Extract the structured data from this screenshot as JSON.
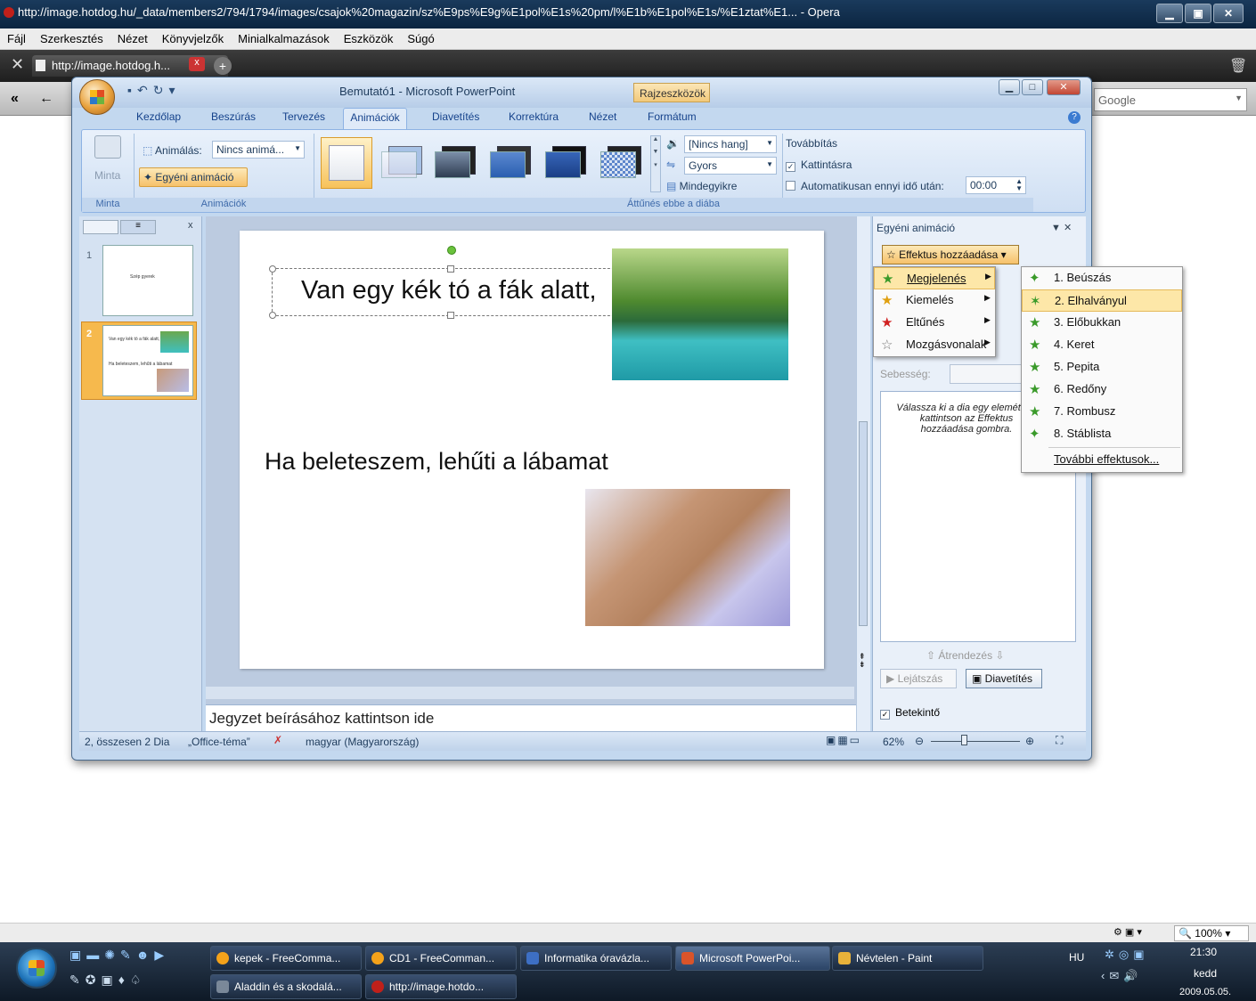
{
  "opera": {
    "title": "http://image.hotdog.hu/_data/members2/794/1794/images/csajok%20magazin/sz%E9ps%E9g%E1pol%E1s%20pm/l%E1b%E1pol%E1s/%E1ztat%E1... - Opera",
    "menu": [
      "Fájl",
      "Szerkesztés",
      "Nézet",
      "Könyvjelzők",
      "Minialkalmazások",
      "Eszközök",
      "Súgó"
    ],
    "tab_label": "http://image.hotdog.h...",
    "tab_close": "x",
    "search_placeholder": "Google",
    "status_zoom": "100%"
  },
  "ppt": {
    "title": "Bemutató1 - Microsoft PowerPoint",
    "context_tab": "Rajzeszközök",
    "tabs": [
      "Kezdőlap",
      "Beszúrás",
      "Tervezés",
      "Animációk",
      "Diavetítés",
      "Korrektúra",
      "Nézet",
      "Formátum"
    ],
    "active_tab": "Animációk",
    "ribbon": {
      "minta_button": "Minta",
      "minta_group": "Minta",
      "animalas_label": "Animálás:",
      "animalas_value": "Nincs animá...",
      "egyeni_animacio": "Egyéni animáció",
      "animaciok_group": "Animációk",
      "sound_value": "[Nincs hang]",
      "speed_value": "Gyors",
      "mindegyikre": "Mindegyikre",
      "transition_group": "Áttűnés ebbe a diába",
      "tovabbitas": "Továbbítás",
      "kattintasra": "Kattintásra",
      "automatikusan": "Automatikusan ennyi idő után:",
      "time_value": "00:00"
    },
    "thumbs": [
      {
        "number": "1",
        "text": "Szép gyerek"
      },
      {
        "number": "2",
        "text": "Van egy kék tó a fák alatt,",
        "text2": "Ha beleteszem, lehűti a lábamat"
      }
    ],
    "slide": {
      "line1": "Van egy kék tó a fák alatt,",
      "line2": "Ha beleteszem, lehűti a lábamat"
    },
    "notes_placeholder": "Jegyzet beírásához kattintson ide",
    "taskpane": {
      "title": "Egyéni animáció",
      "add_effect": "Effektus hozzáadása",
      "speed_label": "Sebesség:",
      "hint": "Válassza ki a dia egy elemét, és kattintson az Effektus hozzáadása gombra.",
      "reorder": "Átrendezés",
      "play": "Lejátszás",
      "slideshow": "Diavetítés",
      "preview": "Betekintő"
    },
    "effect_menu": [
      {
        "label": "Megjelenés",
        "color": "#3a9a2a"
      },
      {
        "label": "Kiemelés",
        "color": "#e0a010"
      },
      {
        "label": "Eltűnés",
        "color": "#d02020"
      },
      {
        "label": "Mozgásvonalak",
        "color": "#888888"
      }
    ],
    "submenu": [
      "1. Beúszás",
      "2. Elhalványul",
      "3. Előbukkan",
      "4. Keret",
      "5. Pepita",
      "6. Redőny",
      "7. Rombusz",
      "8. Stáblista",
      "További effektusok..."
    ],
    "status": {
      "slide_info": "2, összesen 2 Dia",
      "theme": "„Office-téma”",
      "language": "magyar (Magyarország)",
      "zoom": "62%"
    }
  },
  "taskbar": {
    "row1": [
      "kepek - FreeComma...",
      "CD1 - FreeComman...",
      "Informatika óravázla...",
      "Microsoft PowerPoi...",
      "Névtelen - Paint"
    ],
    "row2": [
      "Aladdin és a skodalá...",
      "http://image.hotdo..."
    ],
    "lang": "HU",
    "time": "21:30",
    "day": "kedd",
    "date": "2009.05.05."
  },
  "colors": {
    "ribbon_blue": "#c3d8ef",
    "accent_orange": "#f6b94d"
  }
}
